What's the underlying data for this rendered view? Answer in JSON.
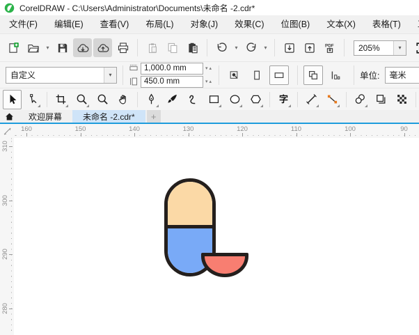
{
  "window": {
    "title": "CorelDRAW - C:\\Users\\Administrator\\Documents\\未命名 -2.cdr*",
    "logo_color": "#2cb34a"
  },
  "menu": {
    "items": [
      {
        "name": "menu-file",
        "label": "文件(F)"
      },
      {
        "name": "menu-edit",
        "label": "编辑(E)"
      },
      {
        "name": "menu-view",
        "label": "查看(V)"
      },
      {
        "name": "menu-layout",
        "label": "布局(L)"
      },
      {
        "name": "menu-object",
        "label": "对象(J)"
      },
      {
        "name": "menu-effects",
        "label": "效果(C)"
      },
      {
        "name": "menu-bitmaps",
        "label": "位图(B)"
      },
      {
        "name": "menu-text",
        "label": "文本(X)"
      },
      {
        "name": "menu-table",
        "label": "表格(T)"
      },
      {
        "name": "menu-tools",
        "label": "工具(T)"
      }
    ]
  },
  "toolbar": {
    "zoom_level": "205%",
    "buttons": [
      {
        "name": "new-document-button",
        "icon": "new-document"
      },
      {
        "name": "open-button",
        "icon": "open-folder",
        "caret": true
      },
      {
        "name": "save-button",
        "icon": "save"
      },
      {
        "name": "cloud-download-button",
        "icon": "cloud-download",
        "state": "pressed"
      },
      {
        "name": "cloud-upload-button",
        "icon": "cloud-upload",
        "state": "pressed"
      },
      {
        "name": "print-button",
        "icon": "print"
      },
      {
        "sep": true
      },
      {
        "name": "cut-button",
        "icon": "clipboard-disabled",
        "state": "disabled"
      },
      {
        "name": "copy-button",
        "icon": "copy-disabled",
        "state": "disabled"
      },
      {
        "name": "paste-button",
        "icon": "paste"
      },
      {
        "sep": true
      },
      {
        "name": "undo-button",
        "icon": "undo",
        "caret": true
      },
      {
        "name": "redo-button",
        "icon": "redo",
        "caret": true
      },
      {
        "sep": true
      },
      {
        "name": "import-button",
        "icon": "import"
      },
      {
        "name": "export-button",
        "icon": "export"
      },
      {
        "name": "publish-pdf-button",
        "icon": "pdf"
      },
      {
        "sep": true
      },
      {
        "combo": true,
        "name": "zoom-level-combo"
      },
      {
        "name": "fullscreen-preview-button",
        "icon": "fullscreen"
      }
    ]
  },
  "property_bar": {
    "preset_value": "自定义",
    "page_width": "1,000.0 mm",
    "page_height": "450.0 mm",
    "units_label": "单位:",
    "units_value": "毫米"
  },
  "toolbox": {
    "tools": [
      {
        "name": "pick-tool",
        "icon": "pick",
        "active": true
      },
      {
        "name": "shape-tool",
        "icon": "shape",
        "flyout": true
      },
      {
        "sep": true
      },
      {
        "name": "crop-tool",
        "icon": "crop",
        "flyout": true
      },
      {
        "name": "zoom-tool",
        "icon": "zoom",
        "flyout": true
      },
      {
        "name": "zoom-tool-secondary",
        "icon": "zoom"
      },
      {
        "name": "pan-tool",
        "icon": "pan"
      },
      {
        "sep": true
      },
      {
        "name": "pen-tool",
        "icon": "pen",
        "flyout": true
      },
      {
        "name": "artistic-media-tool",
        "icon": "brush"
      },
      {
        "name": "smart-drawing-tool",
        "icon": "curve"
      },
      {
        "name": "rectangle-tool",
        "icon": "rectangle",
        "flyout": true
      },
      {
        "name": "ellipse-tool",
        "icon": "ellipse",
        "flyout": true
      },
      {
        "name": "polygon-tool",
        "icon": "polygon",
        "flyout": true
      },
      {
        "sep": true
      },
      {
        "name": "text-tool",
        "icon": "text",
        "flyout": true
      },
      {
        "sep": true
      },
      {
        "name": "dimension-tool",
        "icon": "ruler-line",
        "flyout": true
      },
      {
        "name": "connector-tool",
        "icon": "connector",
        "flyout": true
      },
      {
        "sep": true
      },
      {
        "name": "shadow-tool",
        "icon": "shadow",
        "flyout": true
      },
      {
        "name": "transparency-tool",
        "icon": "layers"
      },
      {
        "name": "interactive-fill-tool",
        "icon": "pattern"
      },
      {
        "sep": true
      },
      {
        "name": "eyedropper-tool",
        "icon": "eyedropper",
        "flyout": true
      }
    ]
  },
  "tabs": {
    "items": [
      {
        "name": "tab-welcome",
        "label": "欢迎屏幕",
        "active": false
      },
      {
        "name": "tab-document",
        "label": "未命名 -2.cdr*",
        "active": true
      }
    ],
    "new_tab_label": "+"
  },
  "rulers": {
    "horizontal_labels": [
      "160",
      "150",
      "140",
      "130",
      "120",
      "110",
      "100",
      "90"
    ],
    "vertical_labels": [
      "310",
      "300",
      "290",
      "280"
    ]
  },
  "canvas": {
    "artwork": {
      "capsule": {
        "top_color": "#FBD9A6",
        "bottom_color": "#79AAF7"
      },
      "bowl": {
        "color": "#F87E71"
      },
      "outline_color": "#241F1D"
    }
  },
  "colors": {
    "tab_accent": "#1e9cdc",
    "active_tab_bg": "#cfe4f8",
    "pressed_button_bg": "#d5d5d5"
  }
}
